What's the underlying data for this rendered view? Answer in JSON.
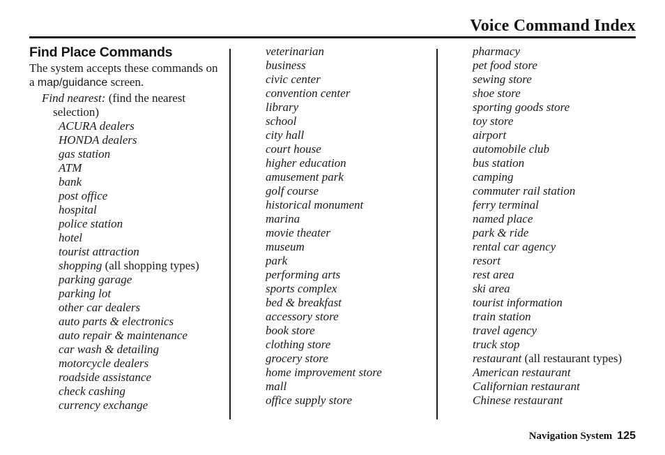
{
  "header": {
    "title": "Voice Command Index"
  },
  "section": {
    "heading": "Find Place Commands",
    "intro_part1": "The system accepts these commands on a ",
    "intro_screen": "map/guidance",
    "intro_part2": " screen.",
    "lead_italic": "Find nearest:",
    "lead_roman": " (find the nearest",
    "lead_continuation": "selection)"
  },
  "columns": [
    {
      "id": "column-1",
      "items": [
        {
          "label": "ACURA dealers",
          "note": ""
        },
        {
          "label": "HONDA dealers",
          "note": ""
        },
        {
          "label": "gas station",
          "note": ""
        },
        {
          "label": "ATM",
          "note": ""
        },
        {
          "label": "bank",
          "note": ""
        },
        {
          "label": "post office",
          "note": ""
        },
        {
          "label": "hospital",
          "note": ""
        },
        {
          "label": "police station",
          "note": ""
        },
        {
          "label": "hotel",
          "note": ""
        },
        {
          "label": "tourist attraction",
          "note": ""
        },
        {
          "label": "shopping",
          "note": " (all shopping types)"
        },
        {
          "label": "parking garage",
          "note": ""
        },
        {
          "label": "parking lot",
          "note": ""
        },
        {
          "label": "other car dealers",
          "note": ""
        },
        {
          "label": "auto parts & electronics",
          "note": ""
        },
        {
          "label": "auto repair & maintenance",
          "note": ""
        },
        {
          "label": "car wash & detailing",
          "note": ""
        },
        {
          "label": "motorcycle dealers",
          "note": ""
        },
        {
          "label": "roadside assistance",
          "note": ""
        },
        {
          "label": "check cashing",
          "note": ""
        },
        {
          "label": "currency exchange",
          "note": ""
        }
      ]
    },
    {
      "id": "column-2",
      "items": [
        {
          "label": "veterinarian",
          "note": ""
        },
        {
          "label": "business",
          "note": ""
        },
        {
          "label": "civic center",
          "note": ""
        },
        {
          "label": "convention center",
          "note": ""
        },
        {
          "label": "library",
          "note": ""
        },
        {
          "label": "school",
          "note": ""
        },
        {
          "label": "city hall",
          "note": ""
        },
        {
          "label": "court house",
          "note": ""
        },
        {
          "label": "higher education",
          "note": ""
        },
        {
          "label": "amusement park",
          "note": ""
        },
        {
          "label": "golf course",
          "note": ""
        },
        {
          "label": "historical monument",
          "note": ""
        },
        {
          "label": "marina",
          "note": ""
        },
        {
          "label": "movie theater",
          "note": ""
        },
        {
          "label": "museum",
          "note": ""
        },
        {
          "label": "park",
          "note": ""
        },
        {
          "label": "performing arts",
          "note": ""
        },
        {
          "label": "sports complex",
          "note": ""
        },
        {
          "label": "bed & breakfast",
          "note": ""
        },
        {
          "label": "accessory store",
          "note": ""
        },
        {
          "label": "book store",
          "note": ""
        },
        {
          "label": "clothing store",
          "note": ""
        },
        {
          "label": "grocery store",
          "note": ""
        },
        {
          "label": "home improvement store",
          "note": ""
        },
        {
          "label": "mall",
          "note": ""
        },
        {
          "label": "office supply store",
          "note": ""
        }
      ]
    },
    {
      "id": "column-3",
      "items": [
        {
          "label": "pharmacy",
          "note": ""
        },
        {
          "label": "pet food store",
          "note": ""
        },
        {
          "label": "sewing store",
          "note": ""
        },
        {
          "label": "shoe store",
          "note": ""
        },
        {
          "label": "sporting goods store",
          "note": ""
        },
        {
          "label": "toy store",
          "note": ""
        },
        {
          "label": "airport",
          "note": ""
        },
        {
          "label": "automobile club",
          "note": ""
        },
        {
          "label": "bus station",
          "note": ""
        },
        {
          "label": "camping",
          "note": ""
        },
        {
          "label": "commuter rail station",
          "note": ""
        },
        {
          "label": "ferry terminal",
          "note": ""
        },
        {
          "label": "named place",
          "note": ""
        },
        {
          "label": "park & ride",
          "note": ""
        },
        {
          "label": "rental car agency",
          "note": ""
        },
        {
          "label": "resort",
          "note": ""
        },
        {
          "label": "rest area",
          "note": ""
        },
        {
          "label": "ski area",
          "note": ""
        },
        {
          "label": "tourist information",
          "note": ""
        },
        {
          "label": "train station",
          "note": ""
        },
        {
          "label": "travel agency",
          "note": ""
        },
        {
          "label": "truck stop",
          "note": ""
        },
        {
          "label": "restaurant",
          "note": " (all restaurant types)"
        },
        {
          "label": "American restaurant",
          "note": ""
        },
        {
          "label": "Californian restaurant",
          "note": ""
        },
        {
          "label": "Chinese restaurant",
          "note": ""
        }
      ]
    }
  ],
  "footer": {
    "book_title": "Navigation System",
    "page_number": "125"
  },
  "colors": {
    "text": "#1a1a1a",
    "rule": "#1c1c1c",
    "background": "#ffffff"
  }
}
